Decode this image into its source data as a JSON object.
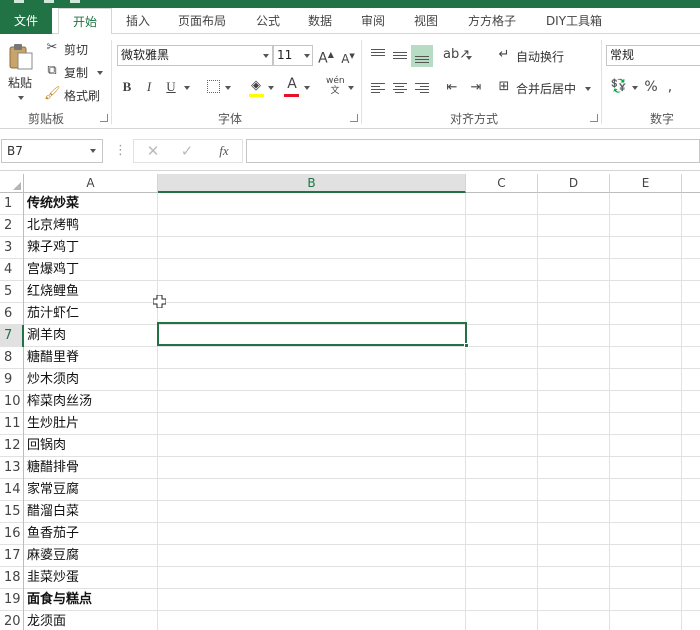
{
  "tabs": {
    "file": "文件",
    "home": "开始",
    "insert": "插入",
    "page_layout": "页面布局",
    "formulas": "公式",
    "data": "数据",
    "review": "审阅",
    "view": "视图",
    "ffgz": "方方格子",
    "diy": "DIY工具箱"
  },
  "ribbon": {
    "clipboard": {
      "paste": "粘贴",
      "cut": "剪切",
      "copy": "复制",
      "format_painter": "格式刷",
      "group": "剪贴板"
    },
    "font": {
      "name": "微软雅黑",
      "size": "11",
      "bold": "B",
      "italic": "I",
      "underline": "U",
      "group": "字体"
    },
    "alignment": {
      "wrap_text": "自动换行",
      "merge_center": "合并后居中",
      "group": "对齐方式"
    },
    "number": {
      "format": "常规",
      "percent": "%",
      "group": "数字"
    }
  },
  "formula_bar": {
    "name_box": "B7",
    "fx": "fx",
    "formula": ""
  },
  "grid": {
    "columns": [
      "A",
      "B",
      "C",
      "D",
      "E"
    ],
    "selected_column": "B",
    "selected_row": 7,
    "rows": [
      {
        "n": "1",
        "a": "传统炒菜",
        "bold": true
      },
      {
        "n": "2",
        "a": "北京烤鸭"
      },
      {
        "n": "3",
        "a": "辣子鸡丁"
      },
      {
        "n": "4",
        "a": "宫爆鸡丁"
      },
      {
        "n": "5",
        "a": "红烧鲤鱼"
      },
      {
        "n": "6",
        "a": "茄汁虾仁"
      },
      {
        "n": "7",
        "a": "涮羊肉"
      },
      {
        "n": "8",
        "a": "糖醋里脊"
      },
      {
        "n": "9",
        "a": "炒木须肉"
      },
      {
        "n": "10",
        "a": "榨菜肉丝汤"
      },
      {
        "n": "11",
        "a": "生炒肚片"
      },
      {
        "n": "12",
        "a": "回锅肉"
      },
      {
        "n": "13",
        "a": "糖醋排骨"
      },
      {
        "n": "14",
        "a": "家常豆腐"
      },
      {
        "n": "15",
        "a": "醋溜白菜"
      },
      {
        "n": "16",
        "a": "鱼香茄子"
      },
      {
        "n": "17",
        "a": "麻婆豆腐"
      },
      {
        "n": "18",
        "a": "韭菜炒蛋"
      },
      {
        "n": "19",
        "a": "面食与糕点",
        "bold": true
      },
      {
        "n": "20",
        "a": "龙须面"
      }
    ]
  },
  "colors": {
    "accent": "#217346",
    "selection_header": "#e1e1e1"
  }
}
